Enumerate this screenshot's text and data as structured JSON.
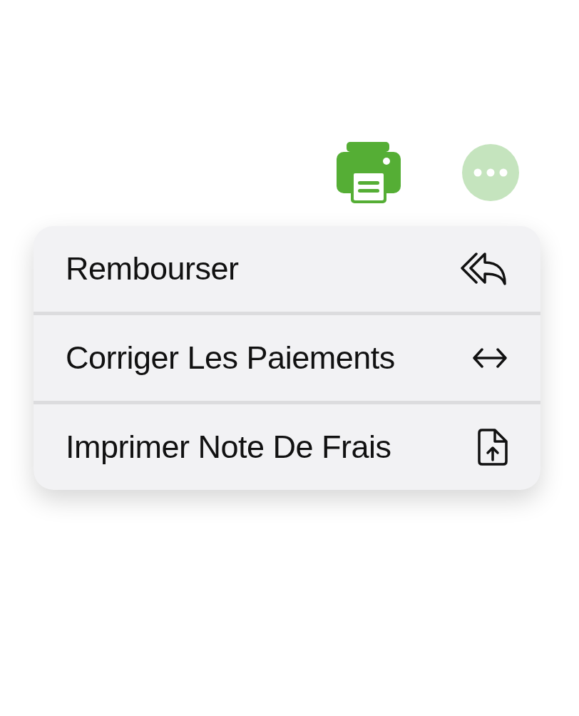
{
  "toolbar": {
    "buttons": [
      {
        "kind": "print"
      },
      {
        "kind": "more"
      }
    ]
  },
  "menu": {
    "items": [
      {
        "label": "Rembourser",
        "kind": "reply-all"
      },
      {
        "label": "Corriger Les Paiements",
        "kind": "swap"
      },
      {
        "label": "Imprimer Note De Frais",
        "kind": "export"
      }
    ]
  }
}
